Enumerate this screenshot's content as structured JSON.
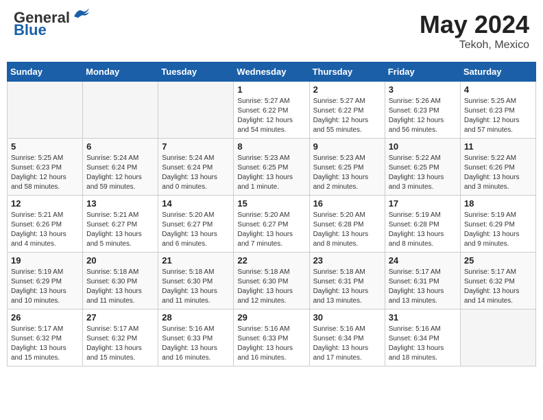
{
  "header": {
    "logo_general": "General",
    "logo_blue": "Blue",
    "month_year": "May 2024",
    "location": "Tekoh, Mexico"
  },
  "days_of_week": [
    "Sunday",
    "Monday",
    "Tuesday",
    "Wednesday",
    "Thursday",
    "Friday",
    "Saturday"
  ],
  "weeks": [
    [
      {
        "day": "",
        "info": ""
      },
      {
        "day": "",
        "info": ""
      },
      {
        "day": "",
        "info": ""
      },
      {
        "day": "1",
        "info": "Sunrise: 5:27 AM\nSunset: 6:22 PM\nDaylight: 12 hours\nand 54 minutes."
      },
      {
        "day": "2",
        "info": "Sunrise: 5:27 AM\nSunset: 6:22 PM\nDaylight: 12 hours\nand 55 minutes."
      },
      {
        "day": "3",
        "info": "Sunrise: 5:26 AM\nSunset: 6:23 PM\nDaylight: 12 hours\nand 56 minutes."
      },
      {
        "day": "4",
        "info": "Sunrise: 5:25 AM\nSunset: 6:23 PM\nDaylight: 12 hours\nand 57 minutes."
      }
    ],
    [
      {
        "day": "5",
        "info": "Sunrise: 5:25 AM\nSunset: 6:23 PM\nDaylight: 12 hours\nand 58 minutes."
      },
      {
        "day": "6",
        "info": "Sunrise: 5:24 AM\nSunset: 6:24 PM\nDaylight: 12 hours\nand 59 minutes."
      },
      {
        "day": "7",
        "info": "Sunrise: 5:24 AM\nSunset: 6:24 PM\nDaylight: 13 hours\nand 0 minutes."
      },
      {
        "day": "8",
        "info": "Sunrise: 5:23 AM\nSunset: 6:25 PM\nDaylight: 13 hours\nand 1 minute."
      },
      {
        "day": "9",
        "info": "Sunrise: 5:23 AM\nSunset: 6:25 PM\nDaylight: 13 hours\nand 2 minutes."
      },
      {
        "day": "10",
        "info": "Sunrise: 5:22 AM\nSunset: 6:25 PM\nDaylight: 13 hours\nand 3 minutes."
      },
      {
        "day": "11",
        "info": "Sunrise: 5:22 AM\nSunset: 6:26 PM\nDaylight: 13 hours\nand 3 minutes."
      }
    ],
    [
      {
        "day": "12",
        "info": "Sunrise: 5:21 AM\nSunset: 6:26 PM\nDaylight: 13 hours\nand 4 minutes."
      },
      {
        "day": "13",
        "info": "Sunrise: 5:21 AM\nSunset: 6:27 PM\nDaylight: 13 hours\nand 5 minutes."
      },
      {
        "day": "14",
        "info": "Sunrise: 5:20 AM\nSunset: 6:27 PM\nDaylight: 13 hours\nand 6 minutes."
      },
      {
        "day": "15",
        "info": "Sunrise: 5:20 AM\nSunset: 6:27 PM\nDaylight: 13 hours\nand 7 minutes."
      },
      {
        "day": "16",
        "info": "Sunrise: 5:20 AM\nSunset: 6:28 PM\nDaylight: 13 hours\nand 8 minutes."
      },
      {
        "day": "17",
        "info": "Sunrise: 5:19 AM\nSunset: 6:28 PM\nDaylight: 13 hours\nand 8 minutes."
      },
      {
        "day": "18",
        "info": "Sunrise: 5:19 AM\nSunset: 6:29 PM\nDaylight: 13 hours\nand 9 minutes."
      }
    ],
    [
      {
        "day": "19",
        "info": "Sunrise: 5:19 AM\nSunset: 6:29 PM\nDaylight: 13 hours\nand 10 minutes."
      },
      {
        "day": "20",
        "info": "Sunrise: 5:18 AM\nSunset: 6:30 PM\nDaylight: 13 hours\nand 11 minutes."
      },
      {
        "day": "21",
        "info": "Sunrise: 5:18 AM\nSunset: 6:30 PM\nDaylight: 13 hours\nand 11 minutes."
      },
      {
        "day": "22",
        "info": "Sunrise: 5:18 AM\nSunset: 6:30 PM\nDaylight: 13 hours\nand 12 minutes."
      },
      {
        "day": "23",
        "info": "Sunrise: 5:18 AM\nSunset: 6:31 PM\nDaylight: 13 hours\nand 13 minutes."
      },
      {
        "day": "24",
        "info": "Sunrise: 5:17 AM\nSunset: 6:31 PM\nDaylight: 13 hours\nand 13 minutes."
      },
      {
        "day": "25",
        "info": "Sunrise: 5:17 AM\nSunset: 6:32 PM\nDaylight: 13 hours\nand 14 minutes."
      }
    ],
    [
      {
        "day": "26",
        "info": "Sunrise: 5:17 AM\nSunset: 6:32 PM\nDaylight: 13 hours\nand 15 minutes."
      },
      {
        "day": "27",
        "info": "Sunrise: 5:17 AM\nSunset: 6:32 PM\nDaylight: 13 hours\nand 15 minutes."
      },
      {
        "day": "28",
        "info": "Sunrise: 5:16 AM\nSunset: 6:33 PM\nDaylight: 13 hours\nand 16 minutes."
      },
      {
        "day": "29",
        "info": "Sunrise: 5:16 AM\nSunset: 6:33 PM\nDaylight: 13 hours\nand 16 minutes."
      },
      {
        "day": "30",
        "info": "Sunrise: 5:16 AM\nSunset: 6:34 PM\nDaylight: 13 hours\nand 17 minutes."
      },
      {
        "day": "31",
        "info": "Sunrise: 5:16 AM\nSunset: 6:34 PM\nDaylight: 13 hours\nand 18 minutes."
      },
      {
        "day": "",
        "info": ""
      }
    ]
  ]
}
